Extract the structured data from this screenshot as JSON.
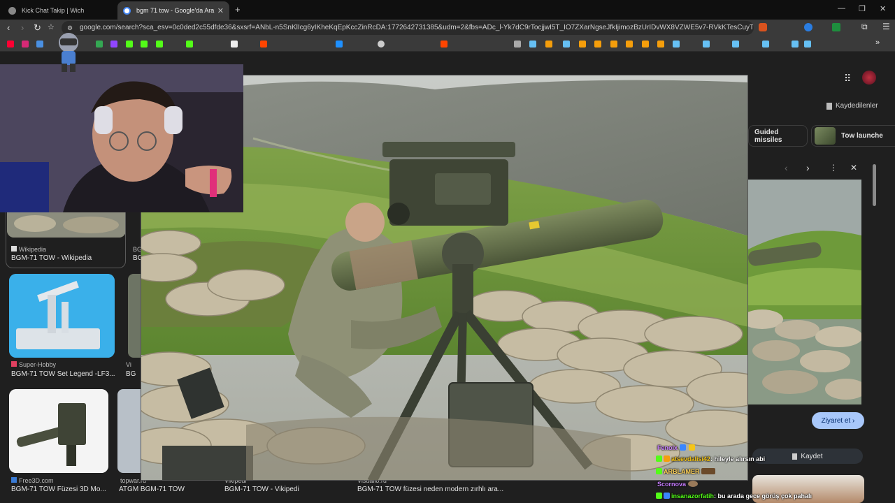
{
  "tabs": [
    {
      "title": "Kick Chat Takip | Wich",
      "active": false
    },
    {
      "title": "bgm 71 tow - Google'da Ara",
      "active": true
    }
  ],
  "address_bar": {
    "url": "google.com/search?sca_esv=0c0ded2c55dfde36&sxsrf=ANbL-n5SnKlIcg6yIKheKqEpKccZinRcDA:1772642731385&udm=2&fbs=ADc_l-Yk7dC9rTocjjwI5T_IO7ZXarNgseJfkIjimozBzUrIDvWX8VZWE5v7-RVkKTesCuyTIf3P1IQB..."
  },
  "header": {
    "saved_label": "Kaydedilenler"
  },
  "filter_chips": [
    {
      "label": "Guided missiles"
    },
    {
      "label": "Tow launche"
    }
  ],
  "results": [
    {
      "source": "Wikipedia",
      "title": "BGM-71 TOW - Wikipedia"
    },
    {
      "source": "Super-Hobby",
      "title": "BGM-71 TOW Set Legend -LF3..."
    },
    {
      "source": "Free3D.com",
      "title": "BGM-71 TOW Füzesi 3D Mo..."
    },
    {
      "source": "topwar.ru",
      "title": "ATGM BGM-71 TOW"
    },
    {
      "source": "Vikipedi",
      "title": "BGM-71 TOW - Vikipedi"
    },
    {
      "source": "Visualio.ru",
      "title": "BGM-71 TOW füzesi neden modern zırhlı ara..."
    },
    {
      "source": "BG",
      "title": "BG"
    },
    {
      "source": "Vi",
      "title": "BG"
    }
  ],
  "side_panel": {
    "visit_label": "Ziyaret et",
    "save_label": "Kaydet"
  },
  "chat": [
    {
      "user": "Fenoix",
      "message": ""
    },
    {
      "user": "atsevdalisi42",
      "message": ": hileyle alırsın abi"
    },
    {
      "user": "ARBLAMER",
      "message": ""
    },
    {
      "user": "Scornova",
      "message": ""
    },
    {
      "user": "insanazorfatih",
      "message": ": bu arada gece görüş çok pahalı"
    }
  ],
  "colors": {
    "accent_blue": "#a8c7fa",
    "chat_user_yellow": "#f5c518",
    "chat_user_purple": "#c77dff",
    "chat_user_green": "#53fc18"
  }
}
